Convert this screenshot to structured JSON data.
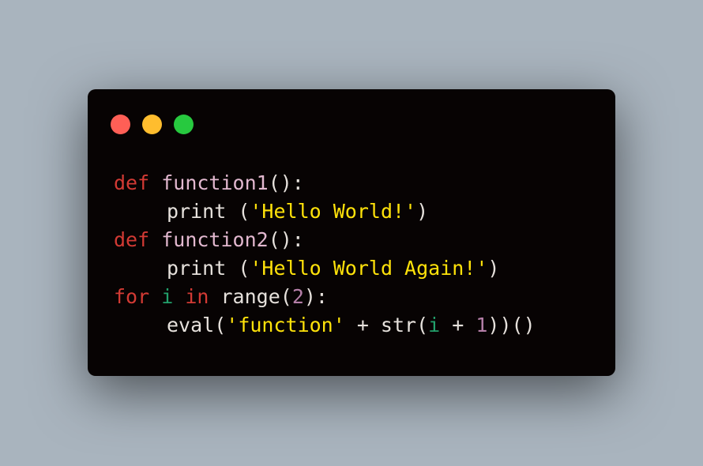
{
  "window": {
    "controls": {
      "close": {
        "color": "#ff5f56"
      },
      "minimize": {
        "color": "#ffbd2e"
      },
      "zoom": {
        "color": "#27c93f"
      }
    }
  },
  "colors": {
    "keyword": "#d23a34",
    "function_name": "#e2b8cf",
    "default": "#e6e1dc",
    "string": "#ffe20a",
    "number": "#b57fa8",
    "variable": "#22a06b"
  },
  "code": {
    "lines": [
      {
        "indent": 0,
        "tokens": [
          {
            "text": "def",
            "kind": "keyword"
          },
          {
            "text": " ",
            "kind": "default"
          },
          {
            "text": "function1",
            "kind": "function_name"
          },
          {
            "text": "():",
            "kind": "default"
          }
        ]
      },
      {
        "indent": 1,
        "tokens": [
          {
            "text": "print",
            "kind": "default"
          },
          {
            "text": " (",
            "kind": "default"
          },
          {
            "text": "'Hello World!'",
            "kind": "string"
          },
          {
            "text": ")",
            "kind": "default"
          }
        ]
      },
      {
        "indent": 0,
        "tokens": [
          {
            "text": "def",
            "kind": "keyword"
          },
          {
            "text": " ",
            "kind": "default"
          },
          {
            "text": "function2",
            "kind": "function_name"
          },
          {
            "text": "():",
            "kind": "default"
          }
        ]
      },
      {
        "indent": 1,
        "tokens": [
          {
            "text": "print",
            "kind": "default"
          },
          {
            "text": " (",
            "kind": "default"
          },
          {
            "text": "'Hello World Again!'",
            "kind": "string"
          },
          {
            "text": ")",
            "kind": "default"
          }
        ]
      },
      {
        "indent": 0,
        "tokens": [
          {
            "text": "for",
            "kind": "keyword"
          },
          {
            "text": " ",
            "kind": "default"
          },
          {
            "text": "i",
            "kind": "variable"
          },
          {
            "text": " ",
            "kind": "default"
          },
          {
            "text": "in",
            "kind": "keyword"
          },
          {
            "text": " range(",
            "kind": "default"
          },
          {
            "text": "2",
            "kind": "number"
          },
          {
            "text": "):",
            "kind": "default"
          }
        ]
      },
      {
        "indent": 1,
        "tokens": [
          {
            "text": "eval(",
            "kind": "default"
          },
          {
            "text": "'function'",
            "kind": "string"
          },
          {
            "text": " + str(",
            "kind": "default"
          },
          {
            "text": "i",
            "kind": "variable"
          },
          {
            "text": " + ",
            "kind": "default"
          },
          {
            "text": "1",
            "kind": "number"
          },
          {
            "text": "))()",
            "kind": "default"
          }
        ]
      }
    ]
  }
}
